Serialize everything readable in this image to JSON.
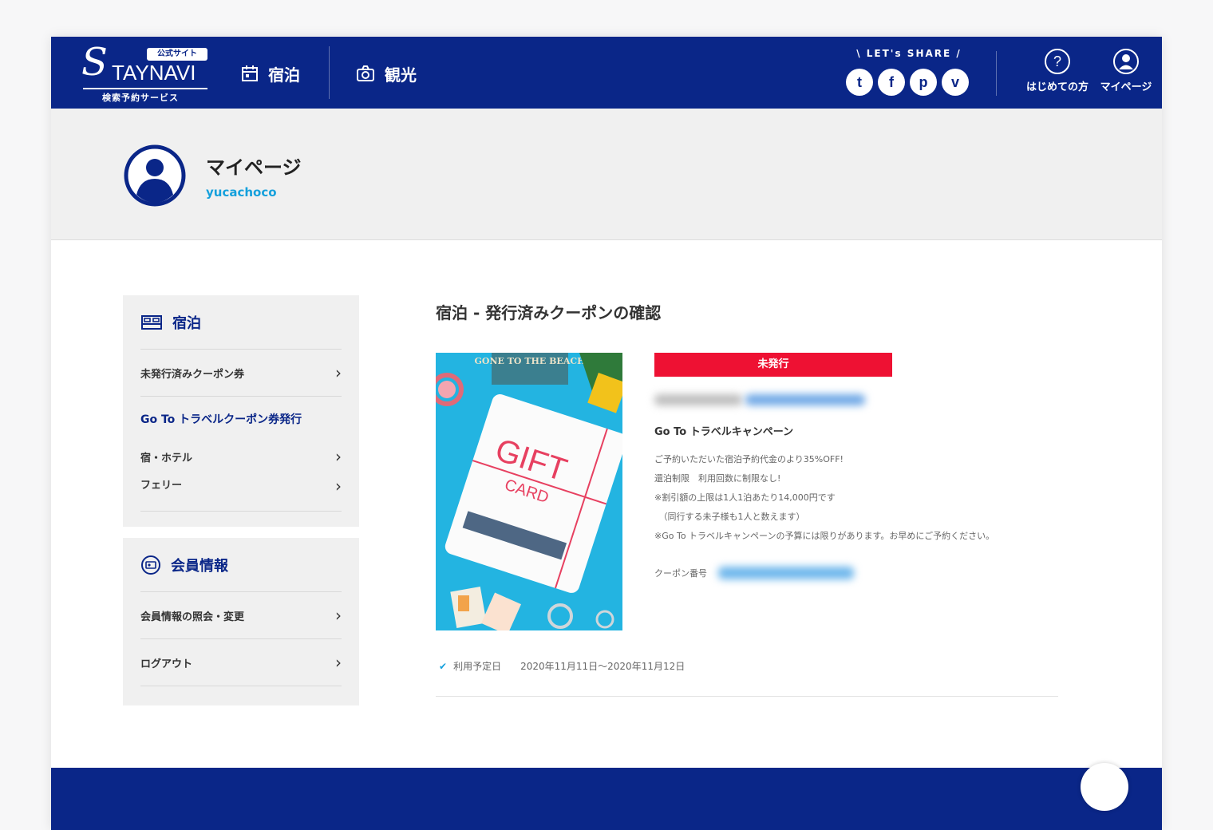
{
  "header": {
    "logo_badge": "公式サイト",
    "logo_mark": "S",
    "logo_name": "TAYNAVI",
    "logo_sub": "検索予約サービス",
    "nav": [
      {
        "label": "宿泊",
        "icon": "calendar-icon"
      },
      {
        "label": "観光",
        "icon": "camera-icon"
      }
    ],
    "share_title": "\\ LET's SHARE /",
    "share_icons": [
      {
        "glyph": "t",
        "icon": "twitter-icon"
      },
      {
        "glyph": "f",
        "icon": "facebook-icon"
      },
      {
        "glyph": "p",
        "icon": "pinterest-icon"
      },
      {
        "glyph": "v",
        "icon": "pocket-icon"
      }
    ],
    "help_label": "はじめての方",
    "mypage_label": "マイページ"
  },
  "profile": {
    "title": "マイページ",
    "username": "yucachoco"
  },
  "sidebar": {
    "stay": {
      "heading": "宿泊",
      "unissued_link": "未発行済みクーポン券",
      "goto_title": "Go To トラベルクーポン券発行",
      "hotel_link": "宿・ホテル",
      "ferry_link": "フェリー"
    },
    "member": {
      "heading": "会員情報",
      "profile_link": "会員情報の照会・変更",
      "logout_link": "ログアウト"
    }
  },
  "main": {
    "title": "宿泊 - 発行済みクーポンの確認",
    "image": {
      "banner_text": "GONE TO THE BEACH",
      "card_line1": "GIFT",
      "card_line2": "CARD"
    },
    "status": "未発行",
    "campaign": "Go To トラベルキャンペーン",
    "description": [
      "ご予約いただいた宿泊予約代金のより35%OFF!",
      "還泊制限　利用回数に制限なし!",
      "※割引額の上限は1人1泊あたり14,000円です",
      "　（同行する未子様も1人と数えます）",
      "※Go To トラベルキャンペーンの予算には限りがあります。お早めにご予約ください。"
    ],
    "coupon_no_label": "クーポン番号",
    "date_label": "利用予定日",
    "date_value": "2020年11月11日〜2020年11月12日"
  },
  "colors": {
    "brand_navy": "#0a2688",
    "accent_blue": "#14a0dc",
    "status_red": "#ee1133",
    "panel_gray": "#f0f0f0"
  }
}
